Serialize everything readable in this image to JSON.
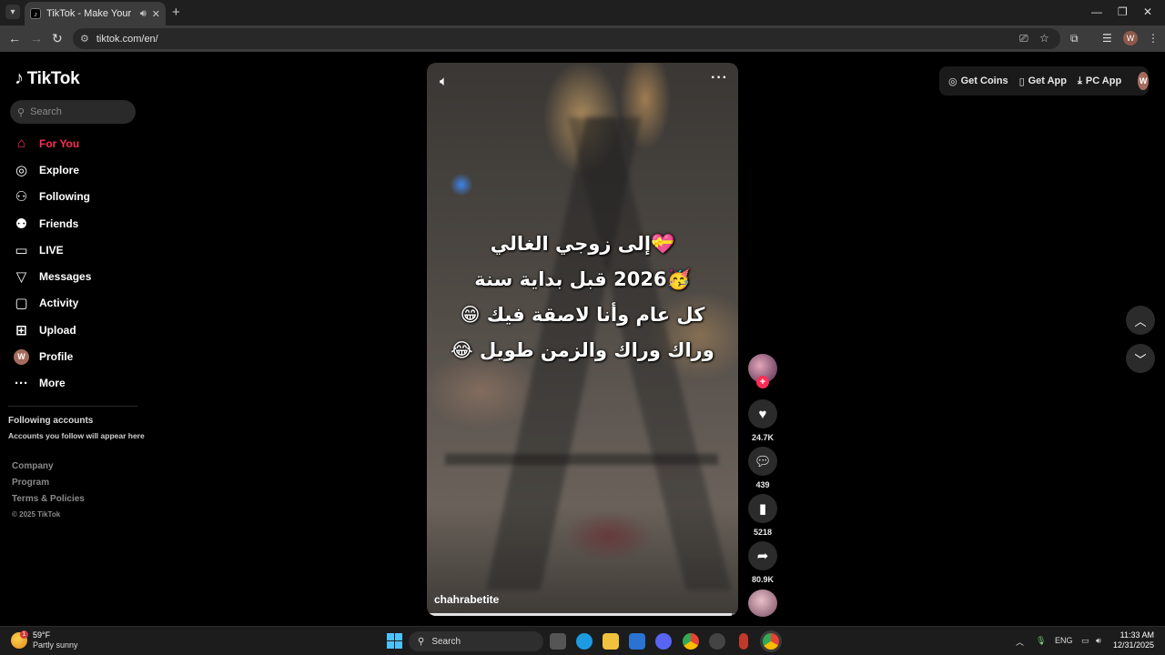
{
  "browser": {
    "tab_title": "TikTok - Make Your Day",
    "url": "tiktok.com/en/"
  },
  "sidebar": {
    "logo": "TikTok",
    "search_placeholder": "Search",
    "nav": [
      {
        "label": "For You",
        "icon": "home-icon",
        "active": true
      },
      {
        "label": "Explore",
        "icon": "compass-icon"
      },
      {
        "label": "Following",
        "icon": "person-icon"
      },
      {
        "label": "Friends",
        "icon": "friends-icon"
      },
      {
        "label": "LIVE",
        "icon": "live-icon"
      },
      {
        "label": "Messages",
        "icon": "send-icon"
      },
      {
        "label": "Activity",
        "icon": "activity-icon"
      },
      {
        "label": "Upload",
        "icon": "upload-icon"
      },
      {
        "label": "Profile",
        "icon": "avatar",
        "avatar_letter": "W"
      },
      {
        "label": "More",
        "icon": "more-icon"
      }
    ],
    "following_title": "Following accounts",
    "following_subtitle": "Accounts you follow will appear here",
    "footer": [
      "Company",
      "Program",
      "Terms & Policies"
    ],
    "copyright": "© 2025 TikTok"
  },
  "video": {
    "caption_lines": [
      "💝إلى زوجي الغالي",
      "🥳2026 قبل بداية سنة",
      "كل عام وأنا لاصقة فيك 😁",
      "وراك وراك والزمن طويل 😂"
    ],
    "author": "chahrabetite",
    "progress": 0.98
  },
  "actions": {
    "likes": "24.7K",
    "comments": "439",
    "saves": "5218",
    "shares": "80.9K"
  },
  "topbar": {
    "coins": "Get Coins",
    "app": "Get App",
    "pc_app": "PC App",
    "user_letter": "W"
  },
  "taskbar": {
    "temperature": "59°F",
    "condition": "Partly sunny",
    "search": "Search",
    "language": "ENG",
    "time": "11:33 AM",
    "date": "12/31/2025"
  },
  "colors": {
    "accent": "#fe2c55",
    "windows_blue": "#4cc2ff"
  }
}
